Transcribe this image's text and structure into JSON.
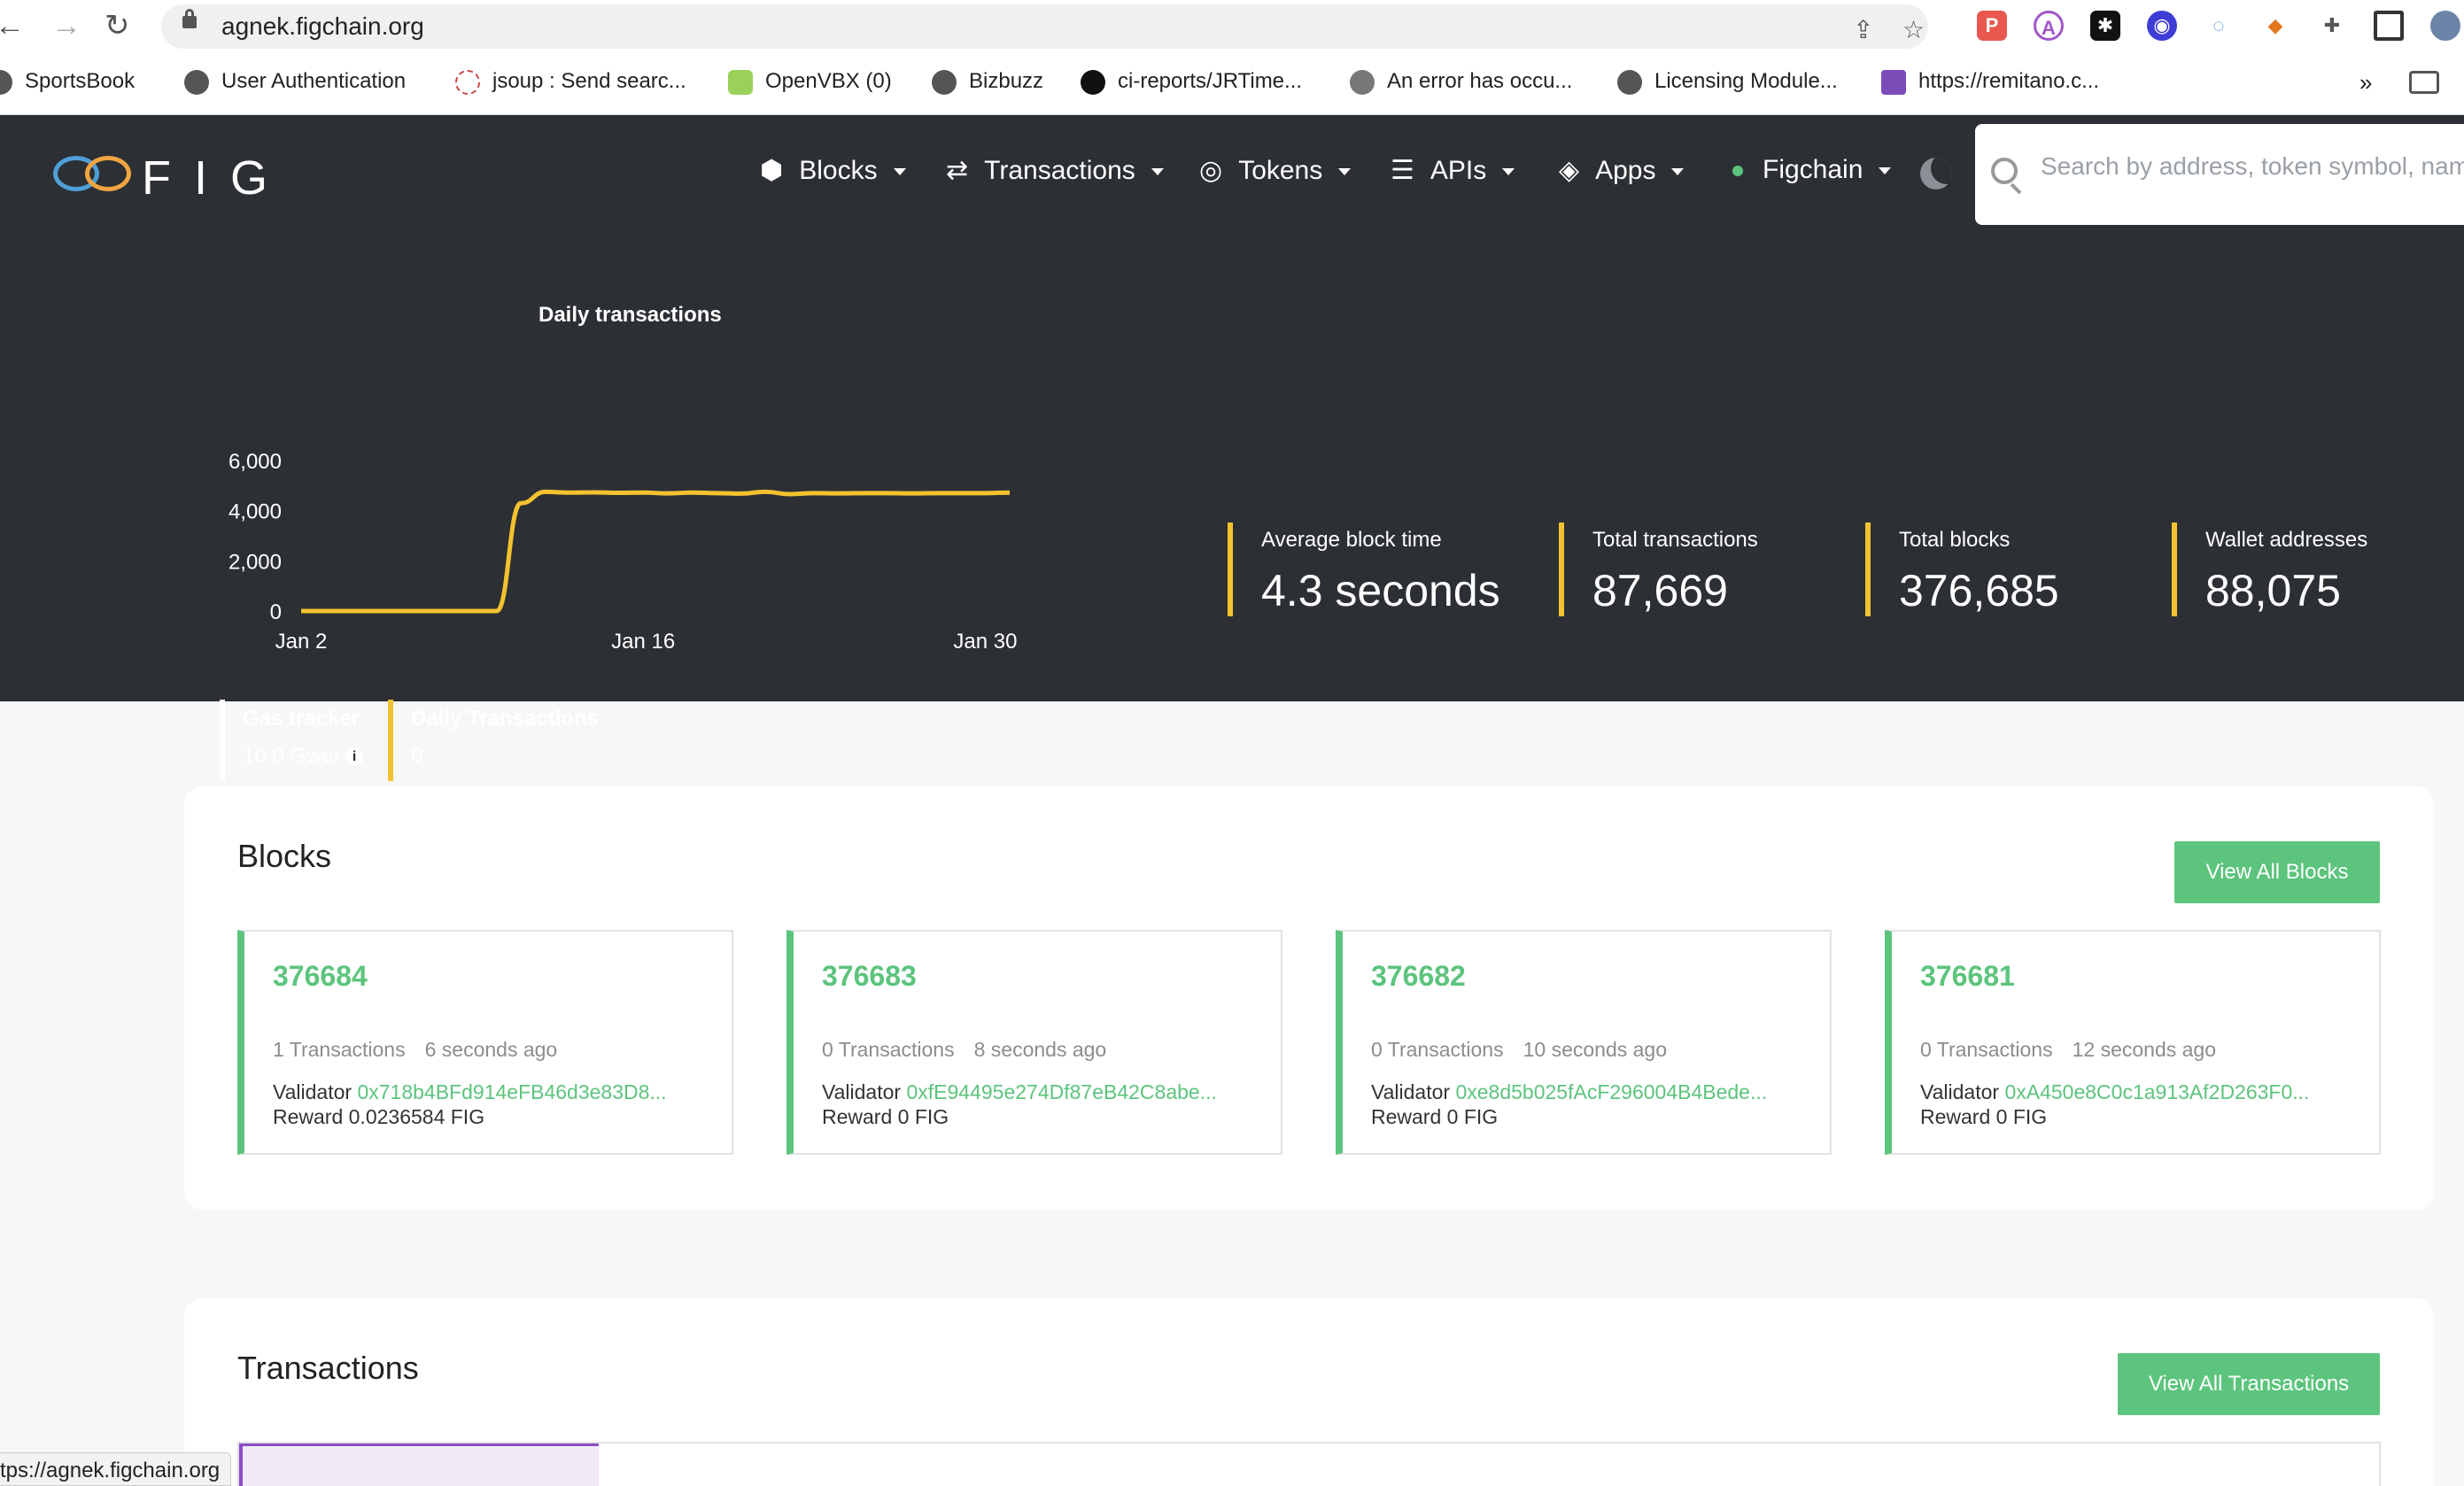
{
  "browser": {
    "url": "agnek.figchain.org",
    "bookmarks": [
      "SportsBook",
      "User Authentication",
      "jsoup : Send searc...",
      "OpenVBX (0)",
      "Bizbuzz",
      "ci-reports/JRTime...",
      "An error has occu...",
      "Licensing Module...",
      "https://remitano.c..."
    ],
    "bookmark_overflow": "»",
    "status_url": "tps://agnek.figchain.org",
    "icons": [
      "back-icon",
      "forward-icon",
      "reload-icon",
      "lock-icon",
      "share-icon",
      "star-icon",
      "extensions-icon",
      "sidebar-icon"
    ]
  },
  "header": {
    "logo_text": "FIG",
    "nav": [
      "Blocks",
      "Transactions",
      "Tokens",
      "APIs",
      "Apps"
    ],
    "network": "Figchain",
    "search_placeholder": "Search by address, token symbol, name"
  },
  "chart_data": {
    "type": "line",
    "title": "Daily transactions",
    "xlabel": "",
    "ylabel": "",
    "x_ticks": [
      "Jan 2",
      "Jan 16",
      "Jan 30"
    ],
    "y_ticks": [
      "6,000",
      "4,000",
      "2,000",
      "0"
    ],
    "ylim": [
      0,
      6000
    ],
    "x": [
      2,
      3,
      4,
      5,
      6,
      7,
      8,
      9,
      10,
      11,
      12,
      13,
      14,
      15,
      16,
      17,
      18,
      19,
      20,
      21,
      22,
      23,
      24,
      25,
      26,
      27,
      28,
      29,
      30,
      31
    ],
    "values": [
      0,
      0,
      0,
      0,
      0,
      0,
      0,
      0,
      0,
      4300,
      4750,
      4720,
      4730,
      4710,
      4720,
      4690,
      4720,
      4700,
      4680,
      4750,
      4660,
      4700,
      4690,
      4700,
      4700,
      4690,
      4700,
      4700,
      4700,
      4720
    ],
    "color": "#f2c230",
    "grid": false
  },
  "stats": [
    {
      "label": "Average block time",
      "value": "4.3 seconds"
    },
    {
      "label": "Total transactions",
      "value": "87,669"
    },
    {
      "label": "Total blocks",
      "value": "376,685"
    },
    {
      "label": "Wallet addresses",
      "value": "88,075"
    }
  ],
  "gas": {
    "label": "Gas tracker",
    "value": "10.0 Gwei"
  },
  "daily_tx": {
    "label": "Daily Transactions",
    "value": "0"
  },
  "blocks": {
    "title": "Blocks",
    "view_all": "View All Blocks",
    "validator_label": "Validator",
    "items": [
      {
        "number": "376684",
        "tx": "1 Transactions",
        "age": "6 seconds ago",
        "validator": "0x718b4BFd914eFB46d3e83D8...",
        "reward": "Reward 0.0236584 FIG"
      },
      {
        "number": "376683",
        "tx": "0 Transactions",
        "age": "8 seconds ago",
        "validator": "0xfE94495e274Df87eB42C8abe...",
        "reward": "Reward 0 FIG"
      },
      {
        "number": "376682",
        "tx": "0 Transactions",
        "age": "10 seconds ago",
        "validator": "0xe8d5b025fAcF296004B4Bede...",
        "reward": "Reward 0 FIG"
      },
      {
        "number": "376681",
        "tx": "0 Transactions",
        "age": "12 seconds ago",
        "validator": "0xA450e8C0c1a913Af2D263F0...",
        "reward": "Reward 0 FIG"
      }
    ]
  },
  "transactions": {
    "title": "Transactions",
    "view_all": "View All Transactions"
  },
  "colors": {
    "accent": "#5cc47d",
    "chart": "#f2c230",
    "header_bg": "#2c2f33"
  }
}
